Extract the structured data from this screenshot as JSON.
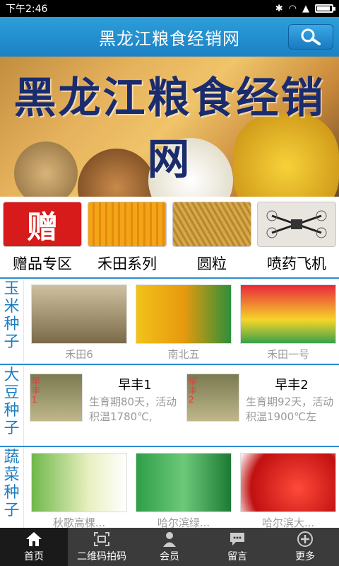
{
  "status": {
    "time": "下午2:46"
  },
  "header": {
    "title": "黑龙江粮食经销网"
  },
  "banner": {
    "title": "黑龙江粮食经销网"
  },
  "categories": [
    {
      "label": "赠品专区",
      "icon": "gift-char",
      "badge": "赠"
    },
    {
      "label": "禾田系列"
    },
    {
      "label": "圆粒"
    },
    {
      "label": "喷药飞机"
    }
  ],
  "sections": {
    "corn": {
      "title": [
        "玉",
        "米",
        "种",
        "子"
      ],
      "items": [
        {
          "name": "禾田6"
        },
        {
          "name": "南北五"
        },
        {
          "name": "禾田一号"
        }
      ]
    },
    "soy": {
      "title": [
        "大",
        "豆",
        "种",
        "子"
      ],
      "items": [
        {
          "name": "早丰1",
          "desc": "生育期80天，活动积温1780℃,",
          "tag": "早丰1"
        },
        {
          "name": "早丰2",
          "desc": "生育期92天，活动积温1900℃左",
          "tag": "早丰2"
        }
      ]
    },
    "veg": {
      "title": [
        "蔬",
        "菜",
        "种",
        "子"
      ],
      "items": [
        {
          "name": "秋歌高棵..."
        },
        {
          "name": "哈尔滨绿..."
        },
        {
          "name": "哈尔滨大..."
        }
      ]
    }
  },
  "tabs": [
    {
      "label": "首页",
      "icon": "home-icon"
    },
    {
      "label": "二维码拍码",
      "icon": "qr-scan-icon"
    },
    {
      "label": "会员",
      "icon": "member-icon"
    },
    {
      "label": "留言",
      "icon": "message-icon"
    },
    {
      "label": "更多",
      "icon": "more-icon"
    }
  ],
  "colors": {
    "accent": "#1b81c4",
    "tabbar": "#3b3b3b",
    "section_title": "#1b7dc2"
  }
}
